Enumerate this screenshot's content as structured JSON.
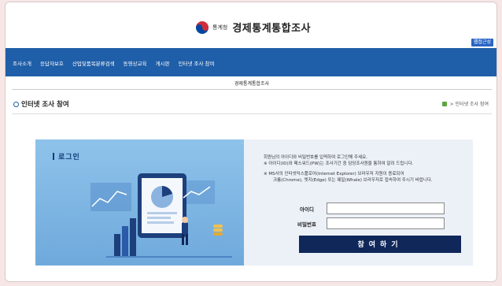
{
  "header": {
    "agency": "통계청",
    "title": "경제통계통합조사",
    "right_button": "웹접근성"
  },
  "nav": {
    "items": [
      "조사소개",
      "응답자보호",
      "산업및품목분류검색",
      "동영상교육",
      "게시판",
      "인터넷 조사 참여"
    ]
  },
  "subtitle": "경제통계통합조사",
  "page": {
    "title": "인터넷 조사 참여",
    "breadcrumb": "> 인터넷 조사 참여"
  },
  "login": {
    "heading": "로그인",
    "notice": [
      "회원님의 아이디와 비밀번호를 입력하여 로그인해 주세요.",
      "※ 아이디(ID)와 패스워드(PW)는 조사기간 중 담당조사원을 통하여 알려 드립니다.",
      "※ MS사의 인터넷익스플로어(Internet Explorer) 브라우저 지원이 종료되어",
      "크롬(Chrome), 엣지(Edge) 또는 웨일(Whale) 브라우저로 접속하여 주시기 바랍니다."
    ],
    "id_label": "아이디",
    "pw_label": "비밀번호",
    "id_value": "",
    "pw_value": "",
    "submit": "참여하기"
  },
  "colors": {
    "nav": "#1f5ea8",
    "panel": "#7db6e4",
    "button": "#10275a",
    "background": "#f7e6e6"
  }
}
